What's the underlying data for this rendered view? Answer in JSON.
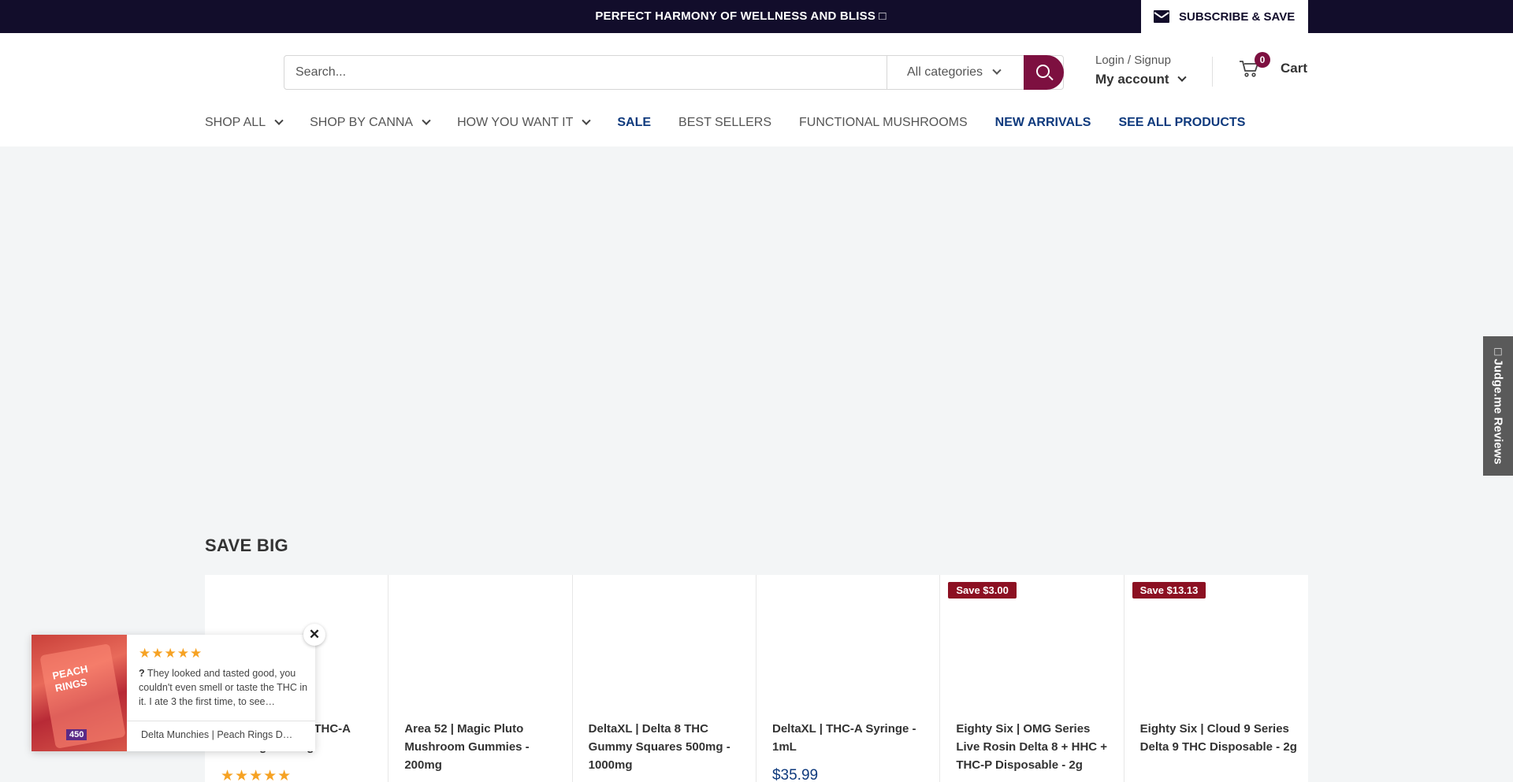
{
  "topbar": {
    "announcement": "PERFECT HARMONY OF  WELLNESS AND BLISS □",
    "subscribe_label": "SUBSCRIBE & SAVE",
    "subscribe_icon": "envelope-icon"
  },
  "header": {
    "search": {
      "placeholder": "Search...",
      "category_label": "All categories",
      "search_icon": "search-icon",
      "accent_color": "#7d1040"
    },
    "account": {
      "login_label": "Login / Signup",
      "my_account_label": "My account"
    },
    "cart": {
      "count": "0",
      "label": "Cart"
    }
  },
  "nav": {
    "items": [
      {
        "label": "SHOP ALL",
        "dropdown": true
      },
      {
        "label": "SHOP BY CANNA",
        "dropdown": true
      },
      {
        "label": "HOW YOU WANT IT",
        "dropdown": true
      },
      {
        "label": "SALE",
        "highlight": true
      },
      {
        "label": "BEST SELLERS"
      },
      {
        "label": "FUNCTIONAL MUSHROOMS"
      },
      {
        "label": "NEW ARRIVALS",
        "highlight": true
      },
      {
        "label": "SEE ALL PRODUCTS",
        "highlight": true
      }
    ]
  },
  "judgeme": {
    "label": "□ Judge.me Reviews"
  },
  "section": {
    "title": "SAVE BIG",
    "products": [
      {
        "title": "Hi Rosin Delta 8 THC-A Cartridge - 2.25g",
        "badge": "",
        "price": "",
        "stars": "★★★★★"
      },
      {
        "title": "Area 52 | Magic Pluto Mushroom Gummies - 200mg",
        "badge": "",
        "price": "",
        "stars": ""
      },
      {
        "title": "DeltaXL | Delta 8 THC Gummy Squares 500mg - 1000mg",
        "badge": "",
        "price": "",
        "stars": ""
      },
      {
        "title": "DeltaXL | THC-A Syringe - 1mL",
        "badge": "",
        "price": "$35.99",
        "stars": ""
      },
      {
        "title": "Eighty Six | OMG Series Live Rosin Delta 8 + HHC + THC-P Disposable - 2g",
        "badge": "Save $3.00",
        "price": "",
        "stars": ""
      },
      {
        "title": "Eighty Six | Cloud 9 Series Delta 9 THC Disposable - 2g",
        "badge": "Save $13.13",
        "price": "",
        "stars": ""
      }
    ]
  },
  "review_popup": {
    "stars": "★★★★★",
    "lead": "?",
    "text": " They looked and tasted good, you couldn't even smell or taste the THC in it. I ate 3 the first time, to see…",
    "product": "Delta Munchies | Peach Rings D…",
    "close_icon": "close-icon"
  }
}
